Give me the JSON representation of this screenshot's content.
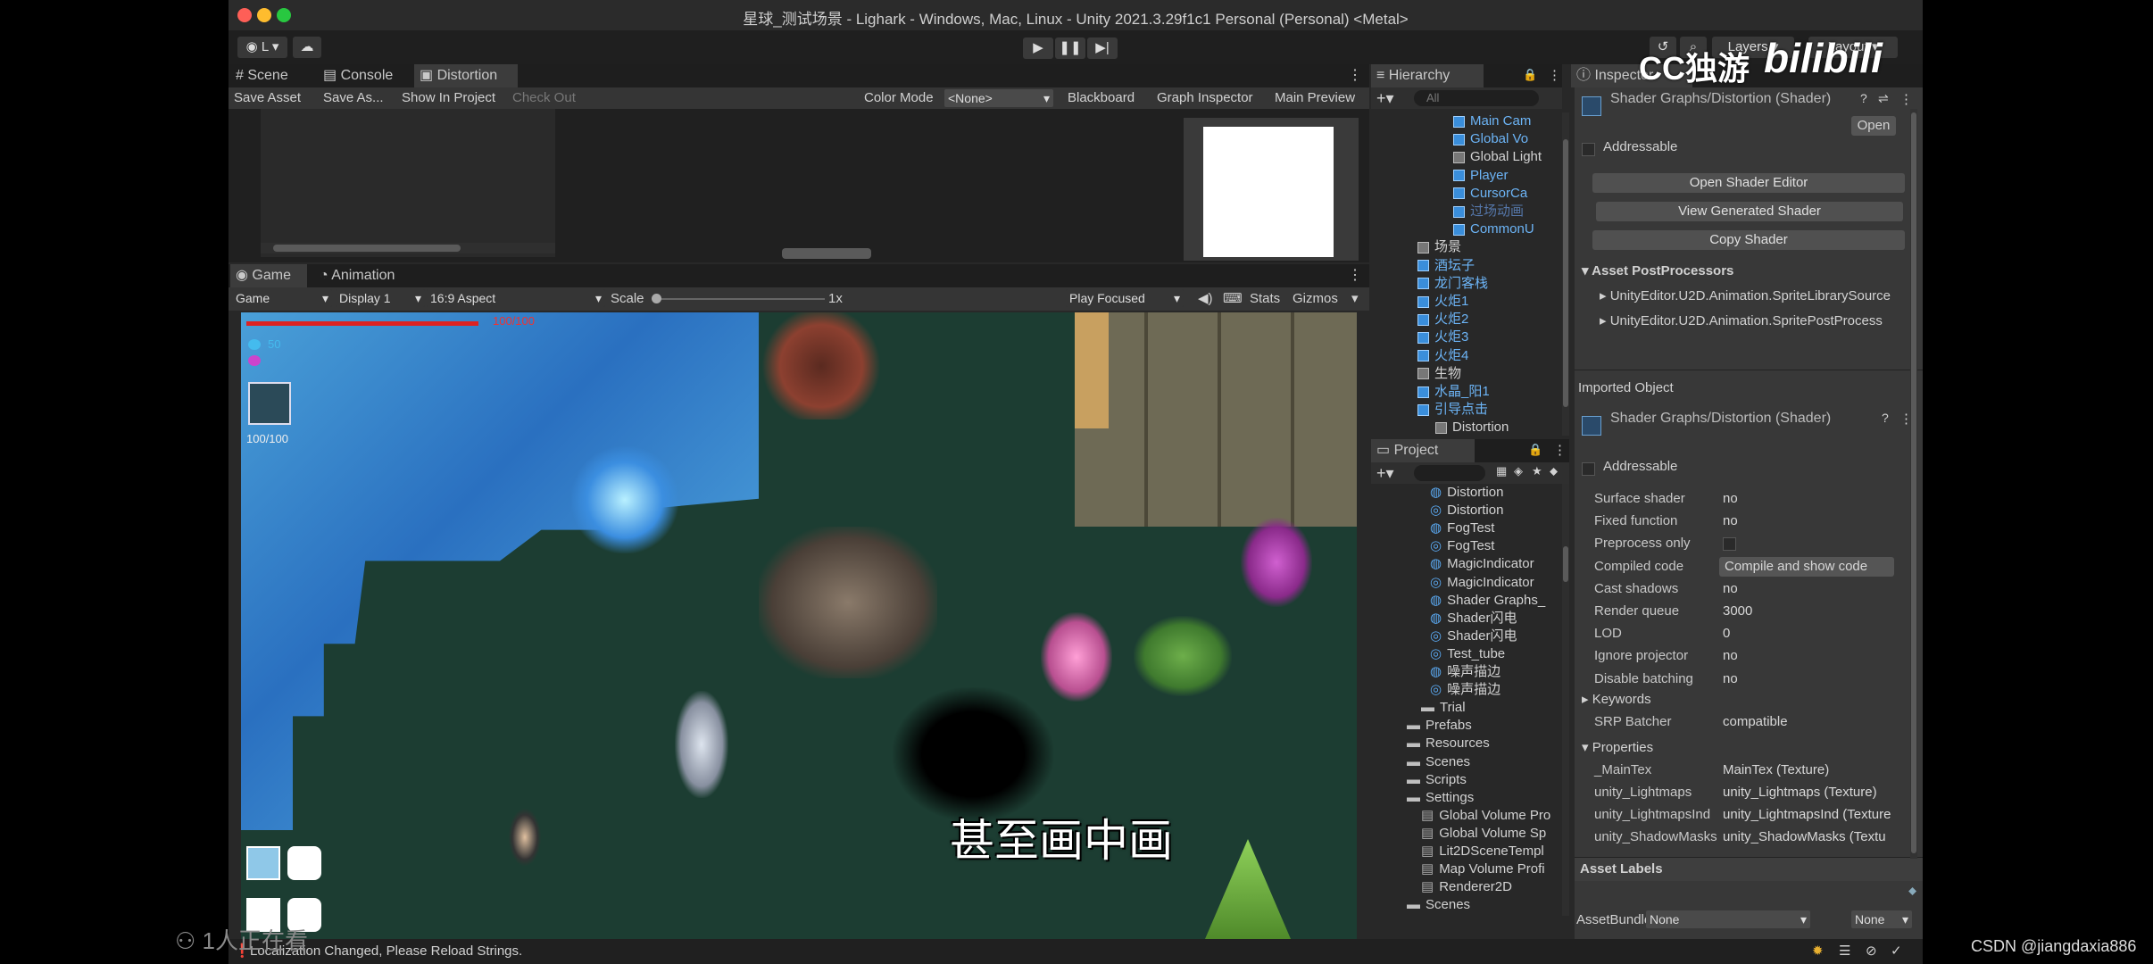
{
  "window": {
    "title": "星球_测试场景 - Lighark - Windows, Mac, Linux - Unity 2021.3.29f1c1 Personal (Personal) <Metal>",
    "account": "L",
    "layers_label": "Layers",
    "layout_label": "Layout"
  },
  "top_tabs": [
    "Scene",
    "Console",
    "Distortion"
  ],
  "shader_graph_toolbar": {
    "save_asset": "Save Asset",
    "save_as": "Save As...",
    "show_in_project": "Show In Project",
    "check_out": "Check Out",
    "color_mode_label": "Color Mode",
    "color_mode_value": "<None>",
    "blackboard": "Blackboard",
    "graph_inspector": "Graph Inspector",
    "main_preview": "Main Preview"
  },
  "game_tabs": [
    "Game",
    "Animation"
  ],
  "game_toolbar": {
    "mode": "Game",
    "display": "Display 1",
    "aspect": "16:9 Aspect",
    "scale_label": "Scale",
    "scale_value": "1x",
    "play_focused": "Play Focused",
    "stats": "Stats",
    "gizmos": "Gizmos"
  },
  "game_hud": {
    "hp_text": "100/100",
    "mana": "50",
    "charge_text": "100/100",
    "subtitle": "甚至画中画"
  },
  "hierarchy": {
    "title": "Hierarchy",
    "search_placeholder": "All",
    "items": [
      {
        "label": "Main Cam",
        "color": "blue"
      },
      {
        "label": "Global Vo",
        "color": "blue"
      },
      {
        "label": "Global Light",
        "color": "white"
      },
      {
        "label": "Player",
        "color": "blue"
      },
      {
        "label": "CursorCa",
        "color": "blue"
      },
      {
        "label": "过场动画",
        "color": "dim"
      },
      {
        "label": "CommonU",
        "color": "blue"
      },
      {
        "label": "场景",
        "color": "white"
      },
      {
        "label": "酒坛子",
        "color": "blue"
      },
      {
        "label": "龙门客栈",
        "color": "blue"
      },
      {
        "label": "火炬1",
        "color": "blue"
      },
      {
        "label": "火炬2",
        "color": "blue"
      },
      {
        "label": "火炬3",
        "color": "blue"
      },
      {
        "label": "火炬4",
        "color": "blue"
      },
      {
        "label": "生物",
        "color": "white"
      },
      {
        "label": "水晶_阳1",
        "color": "blue"
      },
      {
        "label": "引导点击",
        "color": "blue"
      },
      {
        "label": "Distortion",
        "color": "white"
      }
    ]
  },
  "project": {
    "title": "Project",
    "items": [
      {
        "label": "Distortion",
        "icon": "shader"
      },
      {
        "label": "Distortion",
        "icon": "material"
      },
      {
        "label": "FogTest",
        "icon": "shader"
      },
      {
        "label": "FogTest",
        "icon": "material"
      },
      {
        "label": "MagicIndicator",
        "icon": "shader"
      },
      {
        "label": "MagicIndicator",
        "icon": "material"
      },
      {
        "label": "Shader Graphs_",
        "icon": "shader"
      },
      {
        "label": "Shader闪电",
        "icon": "shader"
      },
      {
        "label": "Shader闪电",
        "icon": "material"
      },
      {
        "label": "Test_tube",
        "icon": "material"
      },
      {
        "label": "噪声描边",
        "icon": "shader"
      },
      {
        "label": "噪声描边",
        "icon": "material"
      },
      {
        "label": "Trial",
        "icon": "folder"
      },
      {
        "label": "Prefabs",
        "icon": "folder"
      },
      {
        "label": "Resources",
        "icon": "folder"
      },
      {
        "label": "Scenes",
        "icon": "folder"
      },
      {
        "label": "Scripts",
        "icon": "folder"
      },
      {
        "label": "Settings",
        "icon": "folder"
      },
      {
        "label": "Global Volume Pro",
        "icon": "asset"
      },
      {
        "label": "Global Volume Sp",
        "icon": "asset"
      },
      {
        "label": "Lit2DSceneTempl",
        "icon": "asset"
      },
      {
        "label": "Map Volume Profi",
        "icon": "asset"
      },
      {
        "label": "Renderer2D",
        "icon": "asset"
      },
      {
        "label": "Scenes",
        "icon": "folder"
      }
    ]
  },
  "inspector": {
    "title": "Inspector",
    "header_title": "Shader Graphs/Distortion (Shader)",
    "open": "Open",
    "addressable": "Addressable",
    "open_shader_editor": "Open Shader Editor",
    "view_generated_shader": "View Generated Shader",
    "copy_shader": "Copy Shader",
    "asset_postprocessors": "Asset PostProcessors",
    "postprocessor_1": "UnityEditor.U2D.Animation.SpriteLibrarySource",
    "postprocessor_2": "UnityEditor.U2D.Animation.SpritePostProcess",
    "imported_object": "Imported Object",
    "imported_title": "Shader Graphs/Distortion (Shader)",
    "rows": [
      {
        "k": "Surface shader",
        "v": "no"
      },
      {
        "k": "Fixed function",
        "v": "no"
      },
      {
        "k": "Preprocess only",
        "v": ""
      },
      {
        "k": "Compiled code",
        "v": "Compile and show code"
      },
      {
        "k": "Cast shadows",
        "v": "no"
      },
      {
        "k": "Render queue",
        "v": "3000"
      },
      {
        "k": "LOD",
        "v": "0"
      },
      {
        "k": "Ignore projector",
        "v": "no"
      },
      {
        "k": "Disable batching",
        "v": "no"
      }
    ],
    "keywords": "Keywords",
    "srp_batcher_k": "SRP Batcher",
    "srp_batcher_v": "compatible",
    "properties": "Properties",
    "props": [
      {
        "k": "_MainTex",
        "v": "MainTex (Texture)"
      },
      {
        "k": "unity_Lightmaps",
        "v": "unity_Lightmaps (Texture)"
      },
      {
        "k": "unity_LightmapsInd",
        "v": "unity_LightmapsInd (Texture"
      },
      {
        "k": "unity_ShadowMasks",
        "v": "unity_ShadowMasks (Textu"
      }
    ],
    "asset_labels": "Asset Labels",
    "assetbundle_label": "AssetBundle",
    "assetbundle_value": "None",
    "assetbundle_variant": "None"
  },
  "status": {
    "message": "Localization Changed, Please Reload Strings."
  },
  "overlay": {
    "viewer_count": "1人正在看",
    "watermark_cc": "CC独游",
    "watermark_bili": "bilibili",
    "csdn": "CSDN @jiangdaxia886"
  }
}
